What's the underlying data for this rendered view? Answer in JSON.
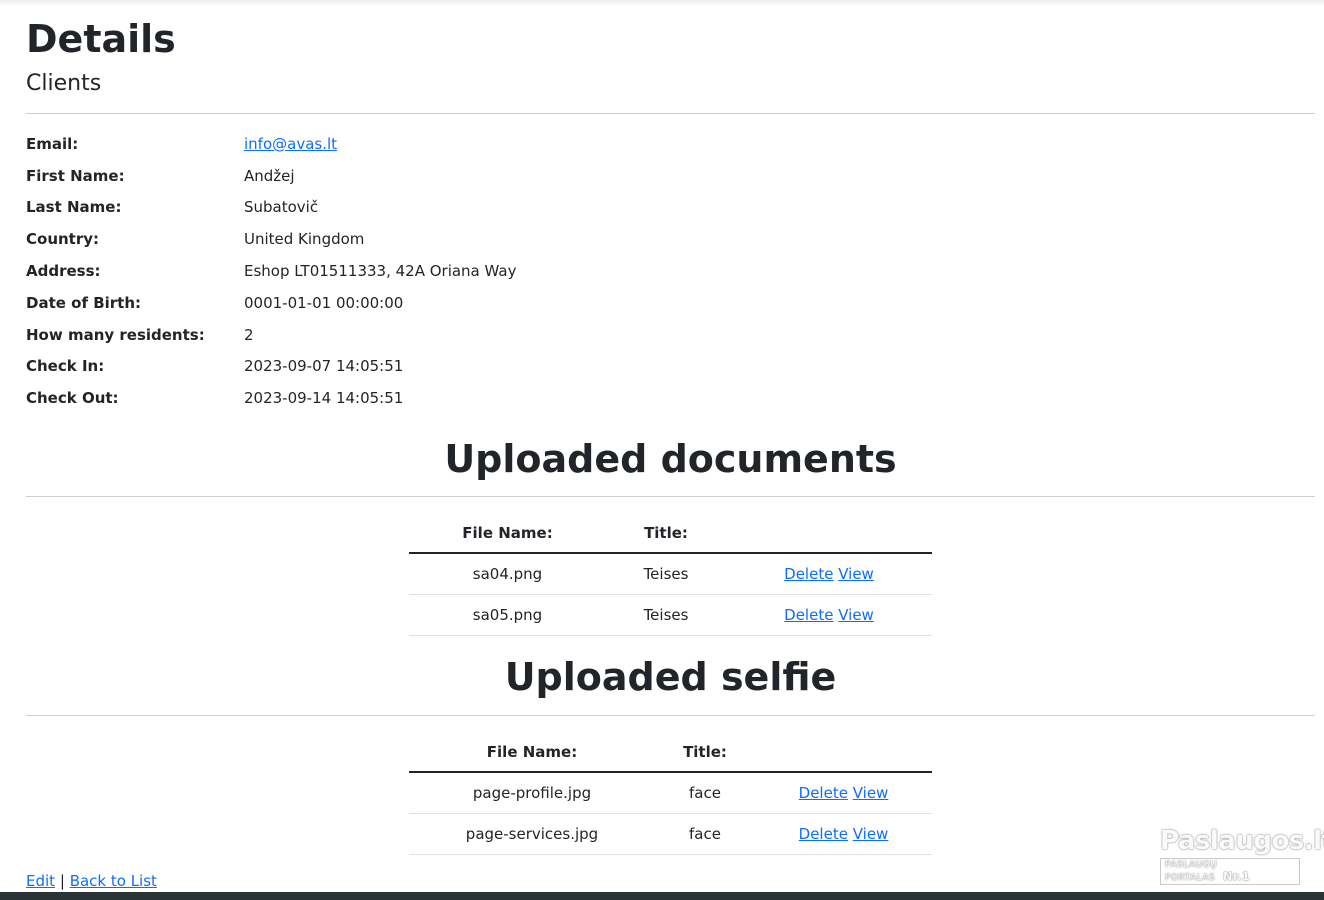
{
  "page": {
    "title": "Details",
    "subtitle": "Clients"
  },
  "details": [
    {
      "label": "Email:",
      "value": "info@avas.lt",
      "link": true
    },
    {
      "label": "First Name:",
      "value": "Andžej"
    },
    {
      "label": "Last Name:",
      "value": "Subatovič"
    },
    {
      "label": "Country:",
      "value": "United Kingdom"
    },
    {
      "label": "Address:",
      "value": "Eshop LT01511333, 42A Oriana Way"
    },
    {
      "label": "Date of Birth:",
      "value": "0001-01-01 00:00:00"
    },
    {
      "label": "How many residents:",
      "value": "2"
    },
    {
      "label": "Check In:",
      "value": "2023-09-07 14:05:51"
    },
    {
      "label": "Check Out:",
      "value": "2023-09-14 14:05:51"
    }
  ],
  "documents": {
    "heading": "Uploaded documents",
    "col_file": "File Name:",
    "col_title": "Title:",
    "rows": [
      {
        "file": "sa04.png",
        "title": "Teises",
        "delete": "Delete",
        "view": "View"
      },
      {
        "file": "sa05.png",
        "title": "Teises",
        "delete": "Delete",
        "view": "View"
      }
    ]
  },
  "selfie": {
    "heading": "Uploaded selfie",
    "col_file": "File Name:",
    "col_title": "Title:",
    "rows": [
      {
        "file": "page-profile.jpg",
        "title": "face",
        "delete": "Delete",
        "view": "View"
      },
      {
        "file": "page-services.jpg",
        "title": "face",
        "delete": "Delete",
        "view": "View"
      }
    ]
  },
  "footer": {
    "edit": "Edit",
    "separator": "|",
    "back": "Back to List"
  },
  "watermark": {
    "brand": "Paslaugos.lt",
    "tagline": "PASLAUGŲ PORTALAS",
    "badge": "Nr.1"
  },
  "colors": {
    "link": "#0d6efd",
    "text": "#212529",
    "footer_bar": "#2a3336"
  }
}
